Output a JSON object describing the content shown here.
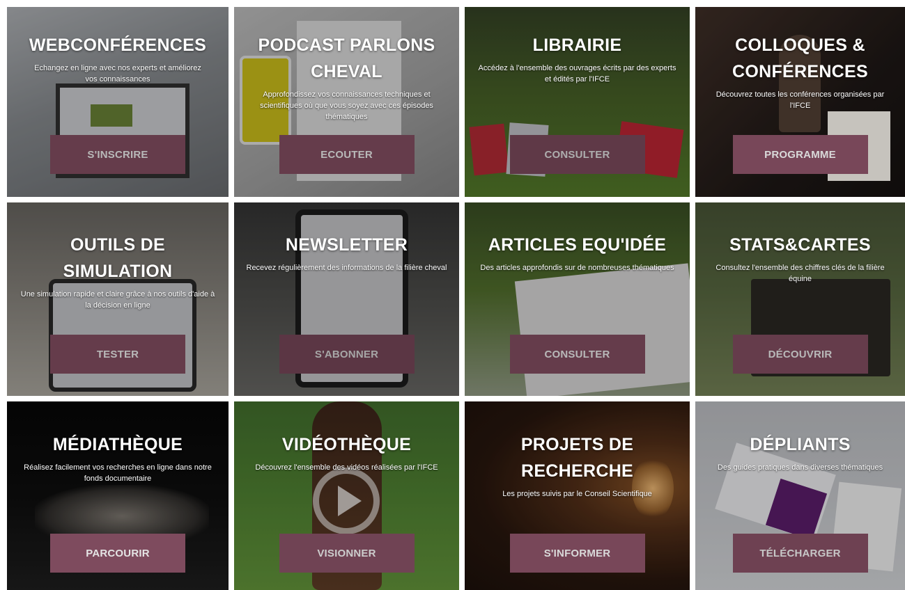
{
  "tiles": [
    {
      "title": "WEBCONFÉRENCES",
      "description": "Echangez en ligne avec nos experts et améliorez vos connaissances",
      "button": "S'INSCRIRE"
    },
    {
      "title": "PODCAST PARLONS CHEVAL",
      "description": "Approfondissez vos connaissances techniques et scientifiques où que vous soyez avec ces épisodes thématiques",
      "button": "ECOUTER"
    },
    {
      "title": "LIBRAIRIE",
      "description": "Accédez à l'ensemble des ouvrages écrits par des experts et édités par l'IFCE",
      "button": "CONSULTER"
    },
    {
      "title": "COLLOQUES & CONFÉRENCES",
      "description": "Découvrez toutes les conférences organisées par l'IFCE",
      "button": "PROGRAMME"
    },
    {
      "title": "OUTILS DE SIMULATION",
      "description": "Une simulation rapide et claire grâce à nos outils d'aide à la décision en ligne",
      "button": "TESTER"
    },
    {
      "title": "NEWSLETTER",
      "description": "Recevez régulièrement des informations de la filière cheval",
      "button": "S'ABONNER"
    },
    {
      "title": "ARTICLES EQU'IDÉE",
      "description": "Des articles approfondis sur de nombreuses thématiques",
      "button": "CONSULTER"
    },
    {
      "title": "STATS&CARTES",
      "description": "Consultez l'ensemble des chiffres clés de la filière équine",
      "button": "DÉCOUVRIR"
    },
    {
      "title": "MÉDIATHÈQUE",
      "description": "Réalisez facilement vos recherches en ligne dans notre fonds documentaire",
      "button": "PARCOURIR"
    },
    {
      "title": "VIDÉOTHÈQUE",
      "description": "Découvrez l'ensemble des vidéos réalisées par l'IFCE",
      "button": "VISIONNER"
    },
    {
      "title": "PROJETS DE RECHERCHE",
      "description": "Les projets suivis par le Conseil Scientifique",
      "button": "S'INFORMER"
    },
    {
      "title": "DÉPLIANTS",
      "description": "Des guides pratiques dans diverses thématiques",
      "button": "TÉLÉCHARGER"
    }
  ],
  "colors": {
    "button": "#8d5469",
    "text": "#ffffff"
  },
  "icons": {
    "video_tile_overlay": "play-icon"
  }
}
